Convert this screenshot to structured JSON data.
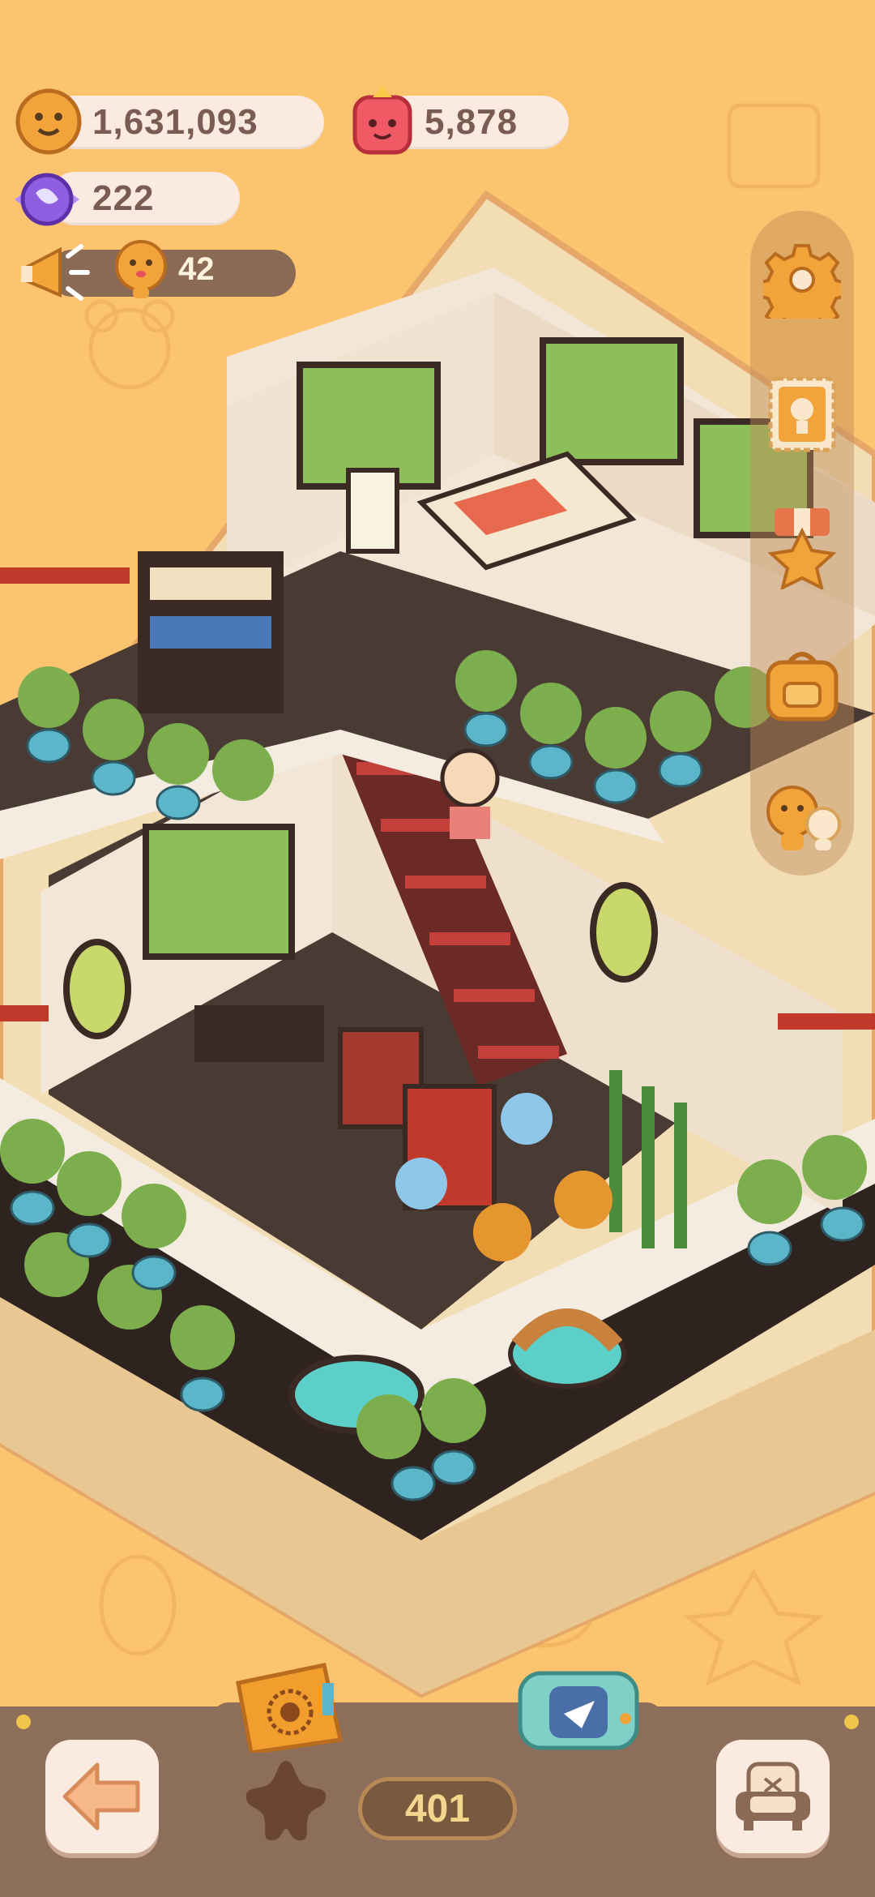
{
  "currencies": {
    "coins": "1,631,093",
    "gems": "5,878",
    "candy": "222",
    "promo_count": "42"
  },
  "level": "401",
  "colors": {
    "background": "#fcc46e",
    "pill": "#fbeae0",
    "pill_text": "#7a5c52",
    "bottom_bar": "#8d6e5a",
    "side_panel": "#be8c5a"
  },
  "icons": {
    "coins": "cookie-coin-icon",
    "gems": "red-gem-icon",
    "candy": "purple-candy-icon",
    "promo": "megaphone-icon",
    "promo_currency": "cookie-character-icon",
    "settings": "gear-icon",
    "stamp": "stamp-icon",
    "medal": "star-medal-icon",
    "bag": "backpack-icon",
    "friends": "friends-icon",
    "back": "back-arrow-icon",
    "collection": "star-cookie-icon",
    "book": "book-icon",
    "camera": "camera-icon",
    "furniture": "armchair-icon"
  }
}
